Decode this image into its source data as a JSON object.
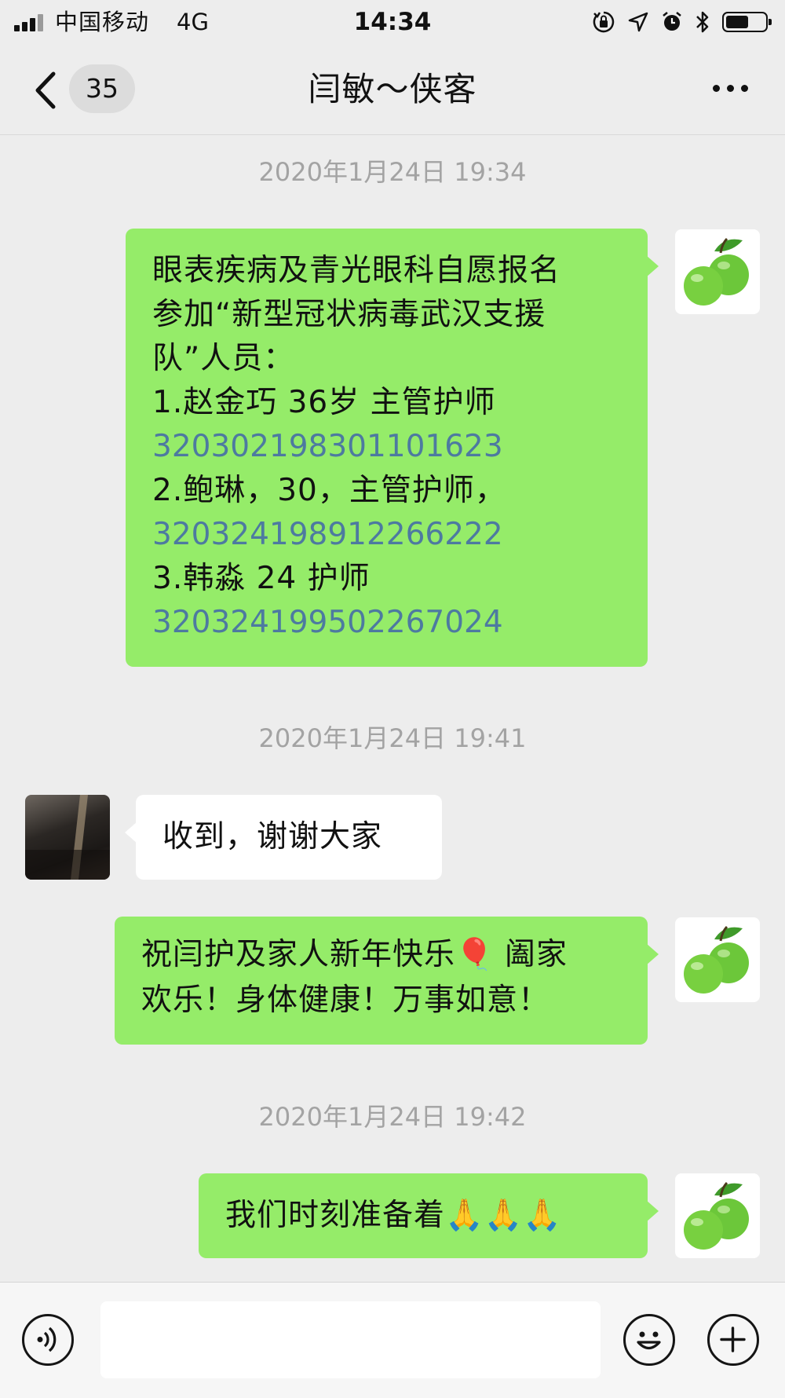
{
  "status_bar": {
    "carrier": "中国移动",
    "network": "4G",
    "time": "14:34",
    "battery_level": 0.6
  },
  "nav": {
    "unread_count": "35",
    "title": "闫敏～侠客"
  },
  "messages": [
    {
      "type": "timestamp",
      "text": "2020年1月24日 19:34"
    },
    {
      "type": "message",
      "from": "me",
      "lines": [
        "眼表疾病及青光眼科自愿报名",
        "参加“新型冠状病毒武汉支援",
        "队”人员：",
        "1.赵金巧 36岁 主管护师",
        "320302198301101623",
        "2.鲍琳，30，主管护师，",
        "320324198912266222",
        "3.韩淼  24  护师",
        "320324199502267024"
      ]
    },
    {
      "type": "timestamp",
      "text": "2020年1月24日 19:41"
    },
    {
      "type": "message",
      "from": "them",
      "lines": [
        "收到，谢谢大家"
      ]
    },
    {
      "type": "message",
      "from": "me",
      "lines": [
        "祝闫护及家人新年快乐🎈 阖家",
        "欢乐！身体健康！万事如意！"
      ]
    },
    {
      "type": "timestamp",
      "text": "2020年1月24日 19:42"
    },
    {
      "type": "message",
      "from": "me",
      "lines": [
        "我们时刻准备着🙏🙏🙏"
      ]
    }
  ],
  "input_bar": {
    "value": "",
    "icons": [
      "voice-icon",
      "emoji-icon",
      "plus-icon"
    ]
  },
  "colors": {
    "background": "#ededed",
    "my_bubble": "#95ec69",
    "their_bubble": "#ffffff",
    "id_number_text": "#4d7aa0",
    "timestamp_text": "#a3a3a3"
  }
}
